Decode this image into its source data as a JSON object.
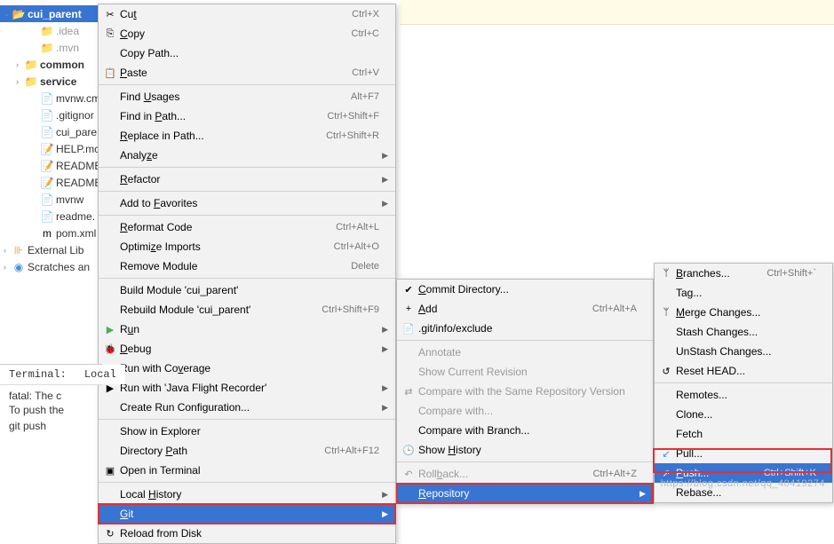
{
  "tree": {
    "root": "cui_parent",
    "items": [
      {
        "label": ".idea",
        "icon": "📁",
        "grey": true
      },
      {
        "label": ".mvn",
        "icon": "📁",
        "grey": true
      },
      {
        "label": "common",
        "icon": "📁",
        "bold": true,
        "exp": true
      },
      {
        "label": "service",
        "icon": "📁",
        "bold": true,
        "exp": true
      },
      {
        "label": "mvnw.cm",
        "icon": "📄"
      },
      {
        "label": ".gitignor",
        "icon": "📄"
      },
      {
        "label": "cui_pare",
        "icon": "📄"
      },
      {
        "label": "HELP.mc",
        "icon": "📝"
      },
      {
        "label": "README",
        "icon": "📝"
      },
      {
        "label": "README",
        "icon": "📝"
      },
      {
        "label": "mvnw",
        "icon": "📄"
      },
      {
        "label": "readme.",
        "icon": "📄"
      },
      {
        "label": "pom.xml",
        "icon": "m"
      }
    ],
    "ext_lib": "External Lib",
    "scratches": "Scratches an"
  },
  "menu1": [
    {
      "icon": "✂",
      "label": "Cut",
      "sc": "Ctrl+X",
      "u": "t"
    },
    {
      "icon": "⎘",
      "label": "Copy",
      "sc": "Ctrl+C",
      "u": "C"
    },
    {
      "label": "Copy Path..."
    },
    {
      "icon": "📋",
      "label": "Paste",
      "sc": "Ctrl+V",
      "u": "P"
    },
    {
      "sep": true
    },
    {
      "label": "Find Usages",
      "sc": "Alt+F7",
      "u": "U"
    },
    {
      "label": "Find in Path...",
      "sc": "Ctrl+Shift+F",
      "u": "P"
    },
    {
      "label": "Replace in Path...",
      "sc": "Ctrl+Shift+R",
      "u": "R"
    },
    {
      "label": "Analyze",
      "sub": true,
      "u": "z"
    },
    {
      "sep": true
    },
    {
      "label": "Refactor",
      "sub": true,
      "u": "R"
    },
    {
      "sep": true
    },
    {
      "label": "Add to Favorites",
      "sub": true,
      "u": "F"
    },
    {
      "sep": true
    },
    {
      "label": "Reformat Code",
      "sc": "Ctrl+Alt+L",
      "u": "R"
    },
    {
      "label": "Optimize Imports",
      "sc": "Ctrl+Alt+O",
      "u": "z"
    },
    {
      "label": "Remove Module",
      "sc": "Delete"
    },
    {
      "sep": true
    },
    {
      "label": "Build Module 'cui_parent'"
    },
    {
      "label": "Rebuild Module 'cui_parent'",
      "sc": "Ctrl+Shift+F9",
      "u": "E"
    },
    {
      "icon": "▶",
      "label": "Run",
      "sub": true,
      "u": "u",
      "green": true
    },
    {
      "icon": "🐞",
      "label": "Debug",
      "sub": true,
      "u": "D"
    },
    {
      "icon": "▶",
      "label": "Run with Coverage",
      "u": "v"
    },
    {
      "icon": "▶",
      "label": "Run with 'Java Flight Recorder'",
      "sub": true
    },
    {
      "label": "Create Run Configuration...",
      "sub": true
    },
    {
      "sep": true
    },
    {
      "label": "Show in Explorer"
    },
    {
      "label": "Directory Path",
      "sc": "Ctrl+Alt+F12",
      "u": "P"
    },
    {
      "icon": "▣",
      "label": "Open in Terminal"
    },
    {
      "sep": true
    },
    {
      "label": "Local History",
      "sub": true,
      "u": "H"
    },
    {
      "label": "Git",
      "sub": true,
      "hi": true,
      "red": true,
      "u": "G"
    },
    {
      "icon": "↻",
      "label": "Reload from Disk"
    }
  ],
  "menu2": [
    {
      "icon": "✔",
      "label": "Commit Directory...",
      "u": "C"
    },
    {
      "icon": "+",
      "label": "Add",
      "sc": "Ctrl+Alt+A",
      "u": "A"
    },
    {
      "icon": "📄",
      "label": ".git/info/exclude"
    },
    {
      "sep": true
    },
    {
      "label": "Annotate",
      "dis": true
    },
    {
      "label": "Show Current Revision",
      "dis": true
    },
    {
      "icon": "⇄",
      "label": "Compare with the Same Repository Version",
      "dis": true
    },
    {
      "label": "Compare with...",
      "dis": true
    },
    {
      "label": "Compare with Branch..."
    },
    {
      "icon": "🕒",
      "label": "Show History",
      "u": "H"
    },
    {
      "sep": true
    },
    {
      "icon": "↶",
      "label": "Rollback...",
      "sc": "Ctrl+Alt+Z",
      "dis": true,
      "u": "b"
    },
    {
      "label": "Repository",
      "sub": true,
      "hi": true,
      "red": true,
      "u": "R"
    }
  ],
  "menu3": [
    {
      "icon": "ᛘ",
      "label": "Branches...",
      "sc": "Ctrl+Shift+`",
      "u": "B"
    },
    {
      "label": "Tag..."
    },
    {
      "icon": "ᛘ",
      "label": "Merge Changes...",
      "u": "M"
    },
    {
      "label": "Stash Changes..."
    },
    {
      "label": "UnStash Changes..."
    },
    {
      "icon": "↺",
      "label": "Reset HEAD..."
    },
    {
      "sep": true
    },
    {
      "label": "Remotes..."
    },
    {
      "label": "Clone..."
    },
    {
      "label": "Fetch"
    },
    {
      "icon": "↙",
      "label": "Pull...",
      "blue": true
    },
    {
      "icon": "↗",
      "label": "Push...",
      "sc": "Ctrl+Shift+K",
      "hi": true,
      "u": "P"
    },
    {
      "label": "Rebase..."
    }
  ],
  "terminal": {
    "tabs": [
      "Terminal:",
      "Local"
    ],
    "lines": [
      "fatal: The c",
      "To push the",
      " ",
      "    git push"
    ]
  },
  "watermark": "https://blog.csdn.net/qq_40419274"
}
